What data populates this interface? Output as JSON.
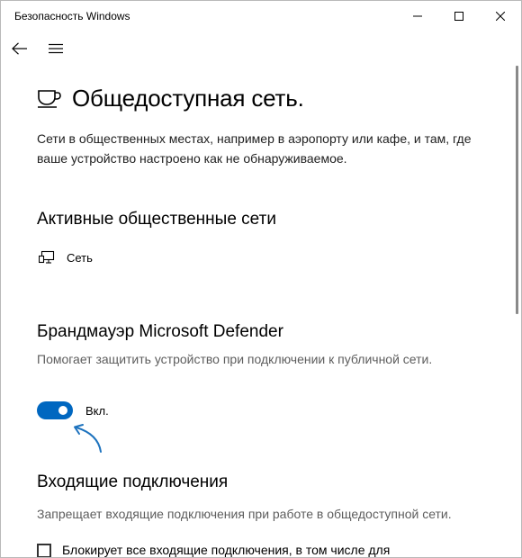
{
  "window": {
    "title": "Безопасность Windows"
  },
  "page": {
    "title": "Общедоступная сеть.",
    "description": "Сети в общественных местах, например в аэропорту или кафе, и там, где ваше устройство настроено как не обнаруживаемое."
  },
  "active_networks": {
    "heading": "Активные общественные сети",
    "items": [
      {
        "label": "Сеть",
        "icon": "network-monitor-icon"
      }
    ]
  },
  "firewall": {
    "heading": "Брандмауэр Microsoft Defender",
    "description": "Помогает защитить устройство при подключении к публичной сети.",
    "toggle_on": true,
    "toggle_label": "Вкл."
  },
  "incoming": {
    "heading": "Входящие подключения",
    "description": "Запрещает входящие подключения при работе в общедоступной сети.",
    "checkbox_checked": false,
    "checkbox_label": "Блокирует все входящие подключения, в том числе для"
  },
  "colors": {
    "accent": "#0067c0",
    "annotation_arrow": "#1e73be"
  },
  "icons": {
    "back": "arrow-left-icon",
    "menu": "hamburger-icon",
    "page": "coffee-cup-icon",
    "minimize": "minimize-icon",
    "maximize": "maximize-icon",
    "close": "close-icon"
  }
}
